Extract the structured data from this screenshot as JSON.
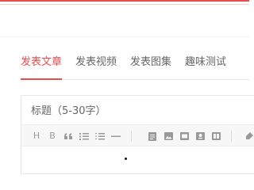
{
  "tabs": [
    {
      "label": "发表文章",
      "active": true
    },
    {
      "label": "发表视频",
      "active": false
    },
    {
      "label": "发表图集",
      "active": false
    },
    {
      "label": "趣味测试",
      "active": false
    }
  ],
  "editor": {
    "title_placeholder": "标题（5-30字）",
    "toolbar": {
      "heading_label": "H",
      "bold_label": "B"
    }
  },
  "colors": {
    "accent": "#e84d4d",
    "tab_text": "#666666",
    "icon": "#999999",
    "toolbar_bg": "#f7f7f7",
    "border": "#e6e6e6"
  }
}
